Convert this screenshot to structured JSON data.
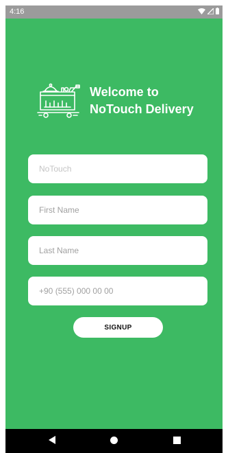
{
  "status_bar": {
    "time": "4:16",
    "icons": [
      "wifi-icon",
      "signal-icon",
      "battery-icon"
    ]
  },
  "header": {
    "logo_icon": "delivery-cart-icon",
    "welcome_line1": "Welcome to",
    "welcome_line2": "NoTouch Delivery"
  },
  "form": {
    "company_placeholder": "NoTouch",
    "first_name_placeholder": "First Name",
    "last_name_placeholder": "Last Name",
    "phone_placeholder": "+90 (555) 000 00 00",
    "signup_label": "SIGNUP"
  },
  "nav_bar": {
    "icons": [
      "back-icon",
      "home-icon",
      "recents-icon"
    ]
  },
  "colors": {
    "background": "#3dba63",
    "status_bar": "#9b9b9b",
    "field": "#ffffff",
    "nav_bar": "#000000"
  }
}
